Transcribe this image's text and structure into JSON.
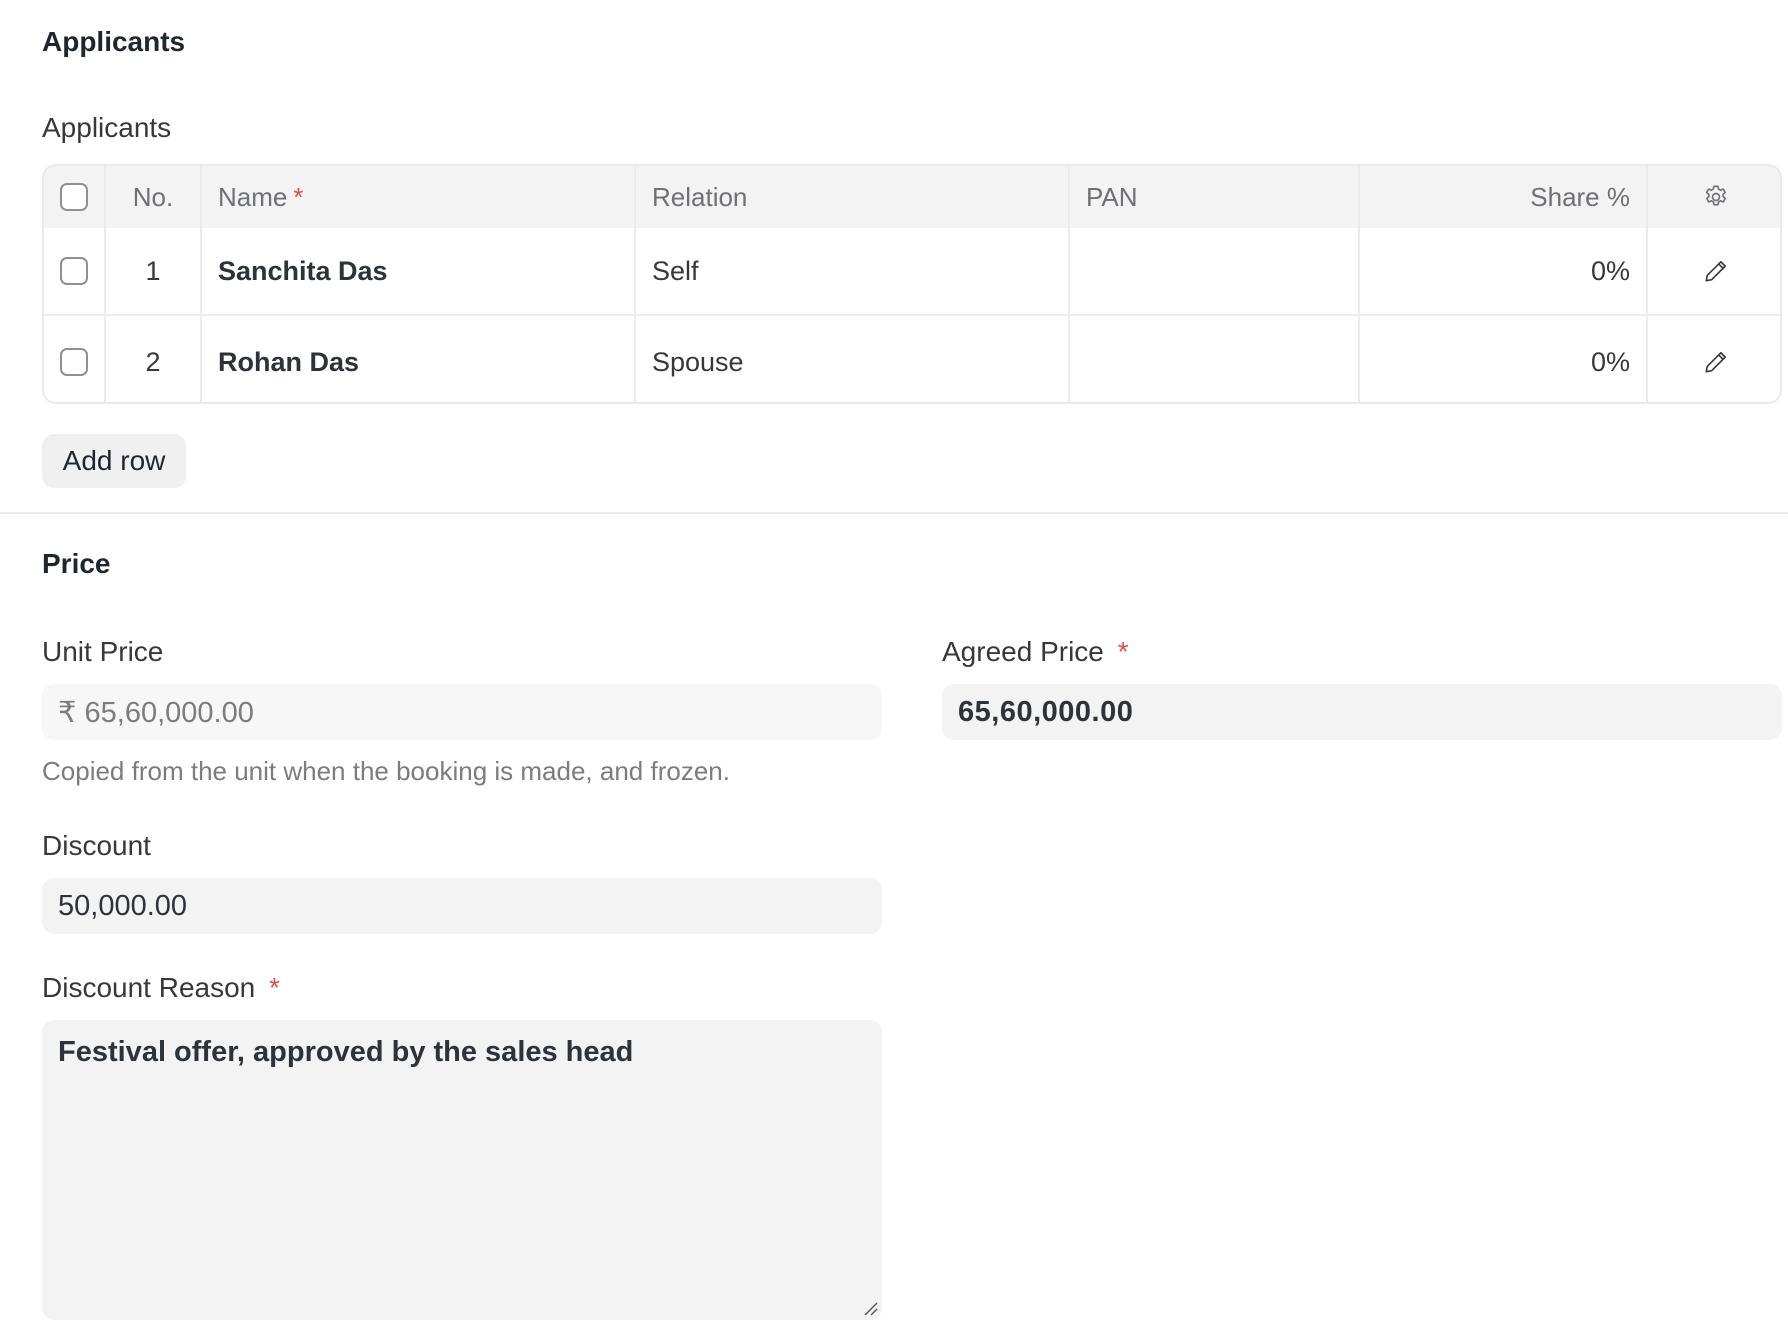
{
  "applicants_section": {
    "title": "Applicants",
    "table_label": "Applicants",
    "columns": {
      "no": "No.",
      "name": "Name",
      "relation": "Relation",
      "pan": "PAN",
      "share": "Share %"
    },
    "required_marker": "*",
    "rows": [
      {
        "no": "1",
        "name": "Sanchita Das",
        "relation": "Self",
        "pan": "",
        "share": "0%"
      },
      {
        "no": "2",
        "name": "Rohan Das",
        "relation": "Spouse",
        "pan": "",
        "share": "0%"
      }
    ],
    "add_row_label": "Add row"
  },
  "price_section": {
    "title": "Price",
    "unit_price": {
      "label": "Unit Price",
      "value": "₹ 65,60,000.00",
      "help": "Copied from the unit when the booking is made, and frozen."
    },
    "agreed_price": {
      "label": "Agreed Price",
      "required_marker": "*",
      "value": "65,60,000.00"
    },
    "discount": {
      "label": "Discount",
      "value": "50,000.00"
    },
    "discount_reason": {
      "label": "Discount Reason",
      "required_marker": "*",
      "value": "Festival offer, approved by the sales head"
    }
  },
  "icons": {
    "settings": "gear-icon",
    "edit": "pencil-icon"
  },
  "colors": {
    "required": "#e24c4c",
    "field_bg": "#f3f3f3",
    "border": "#ebeced"
  }
}
